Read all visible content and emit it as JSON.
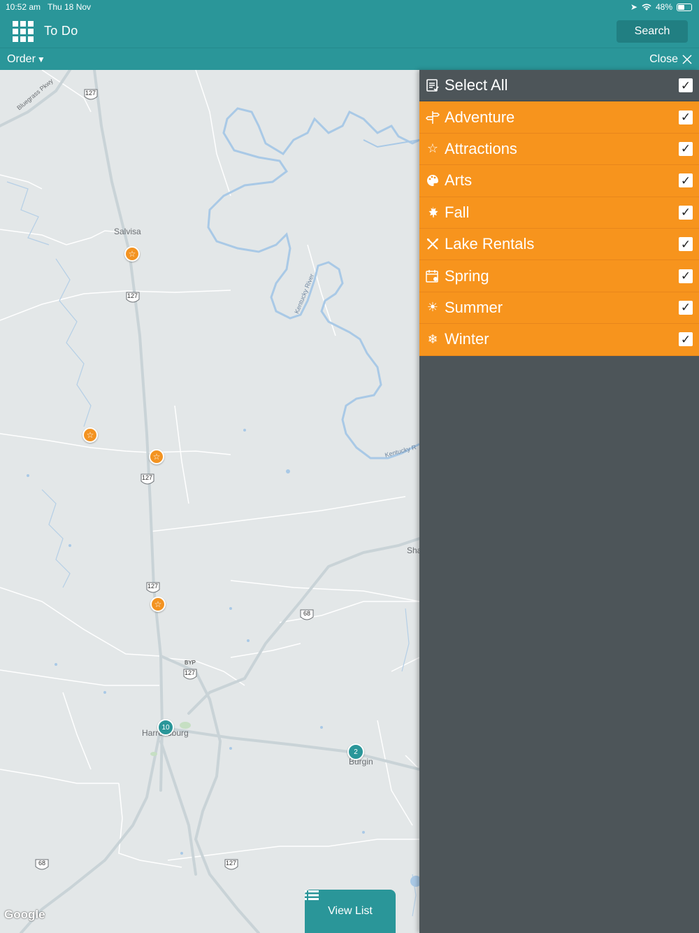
{
  "status_bar": {
    "time": "10:52 am",
    "date": "Thu 18 Nov",
    "battery": "48%"
  },
  "header": {
    "title": "To Do",
    "search_label": "Search",
    "grid_icon": "grid-menu-icon"
  },
  "subbar": {
    "order_label": "Order",
    "close_label": "Close"
  },
  "map": {
    "labels": {
      "salvisa": "Salvisa",
      "harrodsburg": "Harrodsburg",
      "burgin": "Burgin",
      "sha": "Sha",
      "kentucky_river_1": "Kentucky River",
      "kentucky_river_2": "Kentucky R",
      "bluegrass_pkwy": "Bluegrass Pkwy",
      "r127a": "127",
      "r127b": "127",
      "r127c": "127",
      "r127d": "127",
      "r127e": "127",
      "r127f": "127",
      "byp": "BYP",
      "r68a": "68",
      "r68b": "68"
    },
    "clusters": {
      "harrodsburg_count": "10",
      "burgin_count": "2"
    },
    "google": "Google",
    "view_list_label": "View List"
  },
  "filters": {
    "select_all_label": "Select All",
    "categories": [
      {
        "label": "Adventure",
        "icon": "signpost-icon"
      },
      {
        "label": "Attractions",
        "icon": "star-outline-icon"
      },
      {
        "label": "Arts",
        "icon": "palette-icon"
      },
      {
        "label": "Fall",
        "icon": "maple-leaf-icon"
      },
      {
        "label": "Lake Rentals",
        "icon": "paddles-icon"
      },
      {
        "label": "Spring",
        "icon": "calendar-flower-icon"
      },
      {
        "label": "Summer",
        "icon": "sun-icon"
      },
      {
        "label": "Winter",
        "icon": "snowflake-icon"
      }
    ]
  },
  "colors": {
    "teal": "#2a9699",
    "orange": "#f7941d",
    "panel": "#4d5559",
    "map": "#e3e7e8",
    "water": "#a9c9e6"
  }
}
